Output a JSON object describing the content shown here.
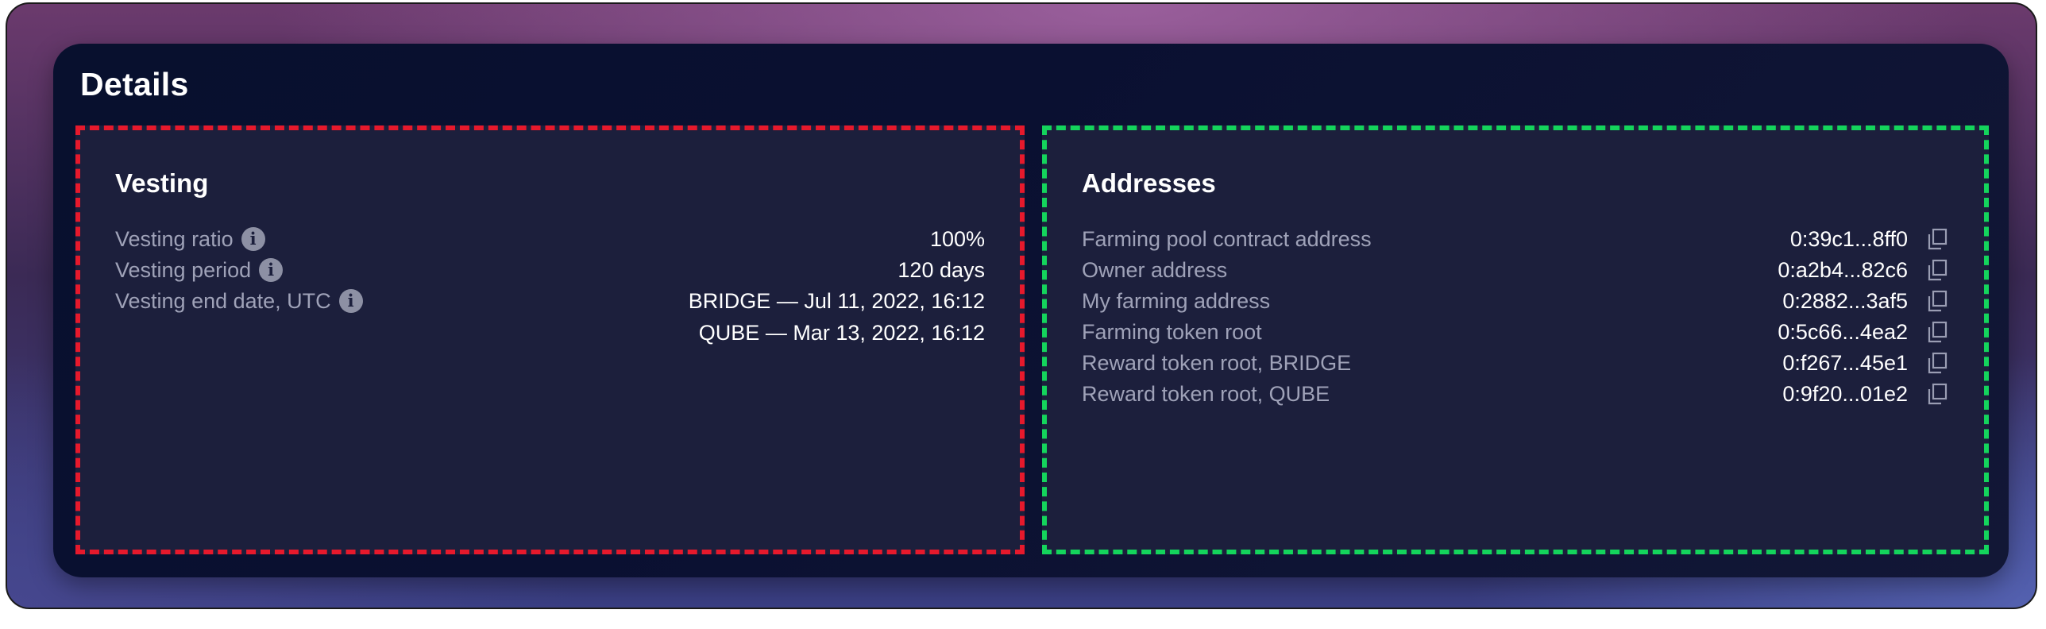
{
  "title": "Details",
  "vesting": {
    "title": "Vesting",
    "rows": [
      {
        "label": "Vesting ratio",
        "value": "100%"
      },
      {
        "label": "Vesting period",
        "value": "120 days"
      },
      {
        "label": "Vesting end date, UTC",
        "values": [
          "BRIDGE — Jul 11, 2022, 16:12",
          "QUBE — Mar 13, 2022, 16:12"
        ]
      }
    ]
  },
  "addresses": {
    "title": "Addresses",
    "rows": [
      {
        "label": "Farming pool contract address",
        "value": "0:39c1...8ff0"
      },
      {
        "label": "Owner address",
        "value": "0:a2b4...82c6"
      },
      {
        "label": "My farming address",
        "value": "0:2882...3af5"
      },
      {
        "label": "Farming token root",
        "value": "0:5c66...4ea2"
      },
      {
        "label": "Reward token root, BRIDGE",
        "value": "0:f267...45e1"
      },
      {
        "label": "Reward token root, QUBE",
        "value": "0:9f20...01e2"
      }
    ]
  },
  "colors": {
    "vesting_border": "#e6192c",
    "addresses_border": "#14d45c",
    "card_bg": "#0a1031",
    "panel_bg": "#1c1f3c"
  },
  "icons": {
    "info": "info-icon",
    "copy": "copy-icon"
  }
}
